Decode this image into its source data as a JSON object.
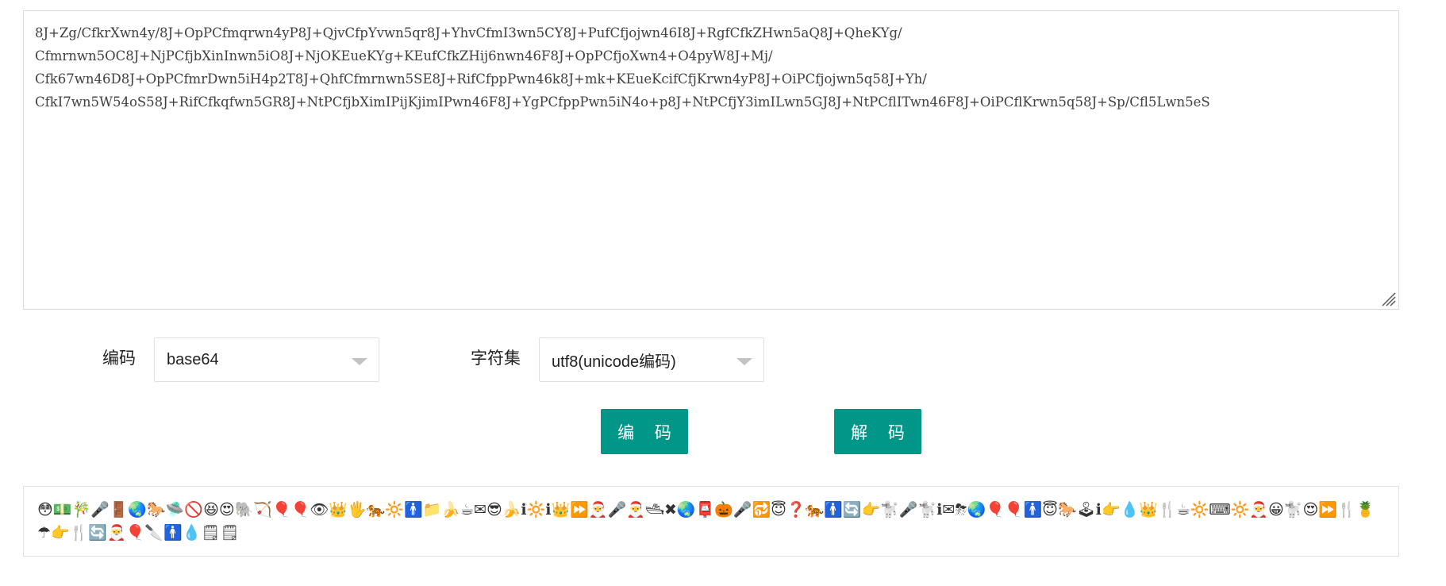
{
  "input": {
    "text": "8J+Zg/CfkrXwn4y/8J+OpPCfmqrwn4yP8J+QjvCfpYvwn5qr8J+YhvCfmI3wn5CY8J+PufCfjojwn46I8J+RgfCfkZHwn5aQ8J+QheKYg/\nCfmrnwn5OC8J+NjPCfjbXinInwn5iO8J+NjOKEueKYg+KEufCfkZHij6nwn46F8J+OpPCfjoXwn4+O4pyW8J+Mj/\nCfk67wn46D8J+OpPCfmrDwn5iH4p2T8J+QhfCfmrnwn5SE8J+RifCfppPwn46k8J+mk+KEueKcifCfjKrwn4yP8J+OiPCfjojwn5q58J+Yh/\nCfkI7wn5W54oS58J+RifCfkqfwn5GR8J+NtPCfjbXimIPijKjimIPwn46F8J+YgPCfppPwn5iN4o+p8J+NtPCfjY3imILwn5GJ8J+NtPCflITwn46F8J+OiPCflKrwn5q58J+Sp/Cfl5Lwn5eS"
  },
  "encoding": {
    "label": "编码",
    "selected": "base64"
  },
  "charset": {
    "label": "字符集",
    "selected": "utf8(unicode编码)"
  },
  "buttons": {
    "encode": "编 码",
    "decode": "解 码"
  },
  "output": {
    "text": "😳💵🎋🎤🚪🌏🐎🛸🚫😆😍🐘🏹🎈🎈👁👑🖐🐅🔆🚹📁🍌☕✉😎🍌ℹ🔆ℹ👑⏩🎅🎤🎅🛥✖🌏📮🎃🎤🔂😇❓🐅🚹🔄👉🐩🎤🐩ℹ✉⛈🌏🎈🎈🚹😇🐎🕹ℹ👉💧👑🍴☕🔆⌨🔆🎅😀🐩😍⏩🍴🍍☂👉🍴🔄🎅🎈🔪🚹💧🗒🗒"
  },
  "colors": {
    "accent": "#009688",
    "border": "#d9d9d9"
  }
}
